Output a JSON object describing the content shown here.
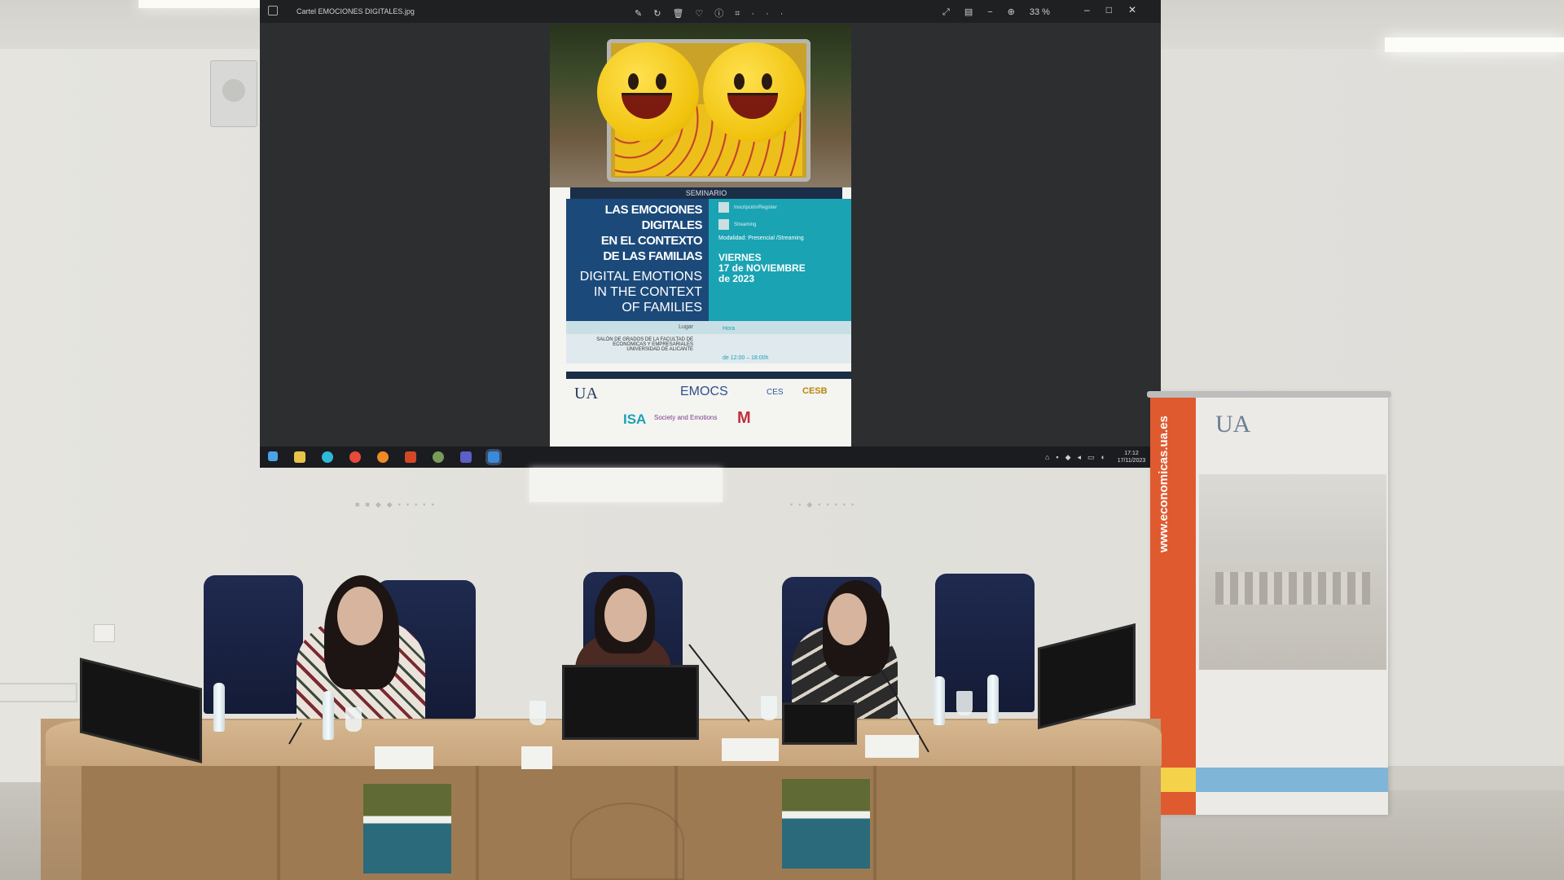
{
  "viewer": {
    "filename": "Cartel EMOCIONES DIGITALES.jpg",
    "zoom": "33 %",
    "tool_icons": [
      "edit-icon",
      "rotate-icon",
      "delete-icon",
      "favorite-icon",
      "info-icon",
      "crop-icon",
      "more-icon"
    ],
    "window_controls": [
      "–",
      "□",
      "✕"
    ]
  },
  "poster": {
    "seminar": "SEMINARIO",
    "title_es": [
      "LAS EMOCIONES",
      "DIGITALES",
      "EN EL CONTEXTO",
      "DE LAS FAMILIAS"
    ],
    "title_en": [
      "DIGITAL EMOTIONS",
      "IN THE CONTEXT",
      "OF FAMILIES"
    ],
    "inscription_label": "Inscripción/Register",
    "streaming_label": "Streaming",
    "modalidad": "Modalidad: Presencial /Streaming",
    "date": [
      "VIERNES",
      "17 de NOVIEMBRE",
      "de 2023"
    ],
    "lugar_label": "Lugar",
    "lugar_text": "SALÓN DE GRADOS DE LA FACULTAD DE ECONÓMICAS Y EMPRESARIALES UNIVERSIDAD DE ALICANTE",
    "hora_label": "Hora",
    "hora": "de 12:00 – 18:00h",
    "logos": {
      "ua": "UA",
      "emocs": "EMOCS",
      "isa": "ISA",
      "society": "Society and Emotions",
      "ces": "CES",
      "cesb": "CESB"
    }
  },
  "taskbar": {
    "time": "17:12",
    "date": "17/11/2023",
    "app_icons": [
      "windows-icon",
      "file-explorer-icon",
      "edge-icon",
      "chrome-icon",
      "firefox-icon",
      "powerpoint-icon",
      "app-icon",
      "teams-icon",
      "photos-icon"
    ]
  },
  "banner": {
    "url": "www.economicas.ua.es",
    "logo": "UA"
  },
  "colors": {
    "poster_blue": "#1b4a7a",
    "poster_teal": "#1aa3b3",
    "banner_orange": "#e05a30",
    "chairs": "#1f2a4f",
    "table_wood": "#c7a47c"
  }
}
